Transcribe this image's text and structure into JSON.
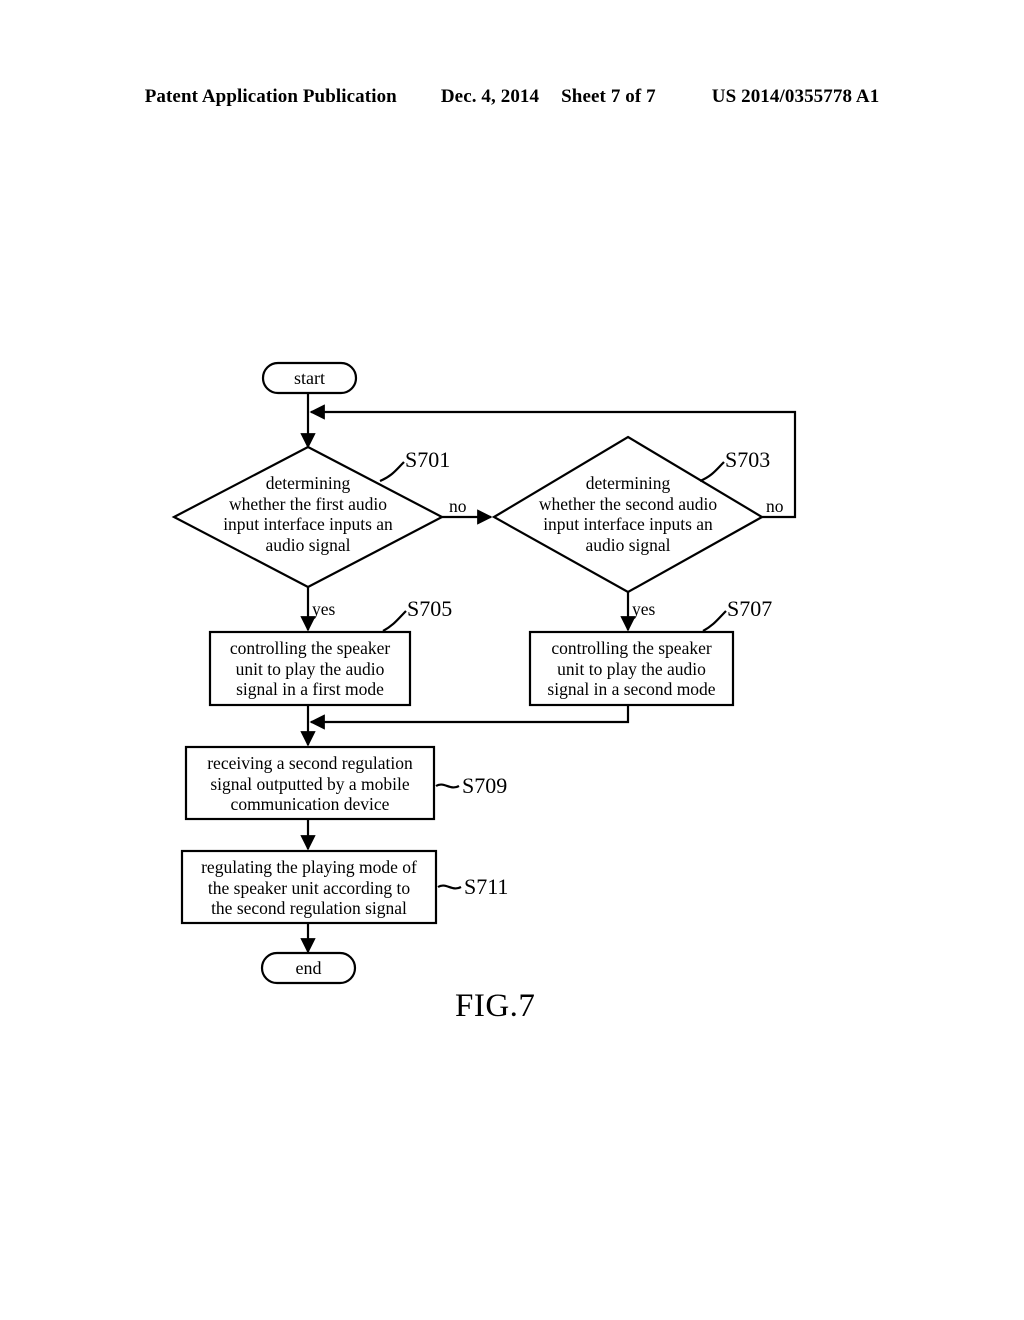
{
  "header": {
    "publication": "Patent Application Publication",
    "date": "Dec. 4, 2014",
    "sheet": "Sheet 7 of 7",
    "patent_number": "US 2014/0355778 A1"
  },
  "figure": {
    "caption": "FIG.7",
    "terminators": {
      "start": "start",
      "end": "end"
    },
    "decisions": [
      {
        "id": "S701",
        "label": "S701",
        "text": "determining\nwhether the first audio\ninput interface inputs an\naudio signal",
        "yes_label": "yes",
        "no_label": "no"
      },
      {
        "id": "S703",
        "label": "S703",
        "text": "determining\nwhether the second audio\ninput interface inputs an\naudio signal",
        "yes_label": "yes",
        "no_label": "no"
      }
    ],
    "processes": [
      {
        "id": "S705",
        "label": "S705",
        "text": "controlling the speaker\nunit to play the audio\nsignal in a first mode"
      },
      {
        "id": "S707",
        "label": "S707",
        "text": "controlling the speaker\nunit to play the audio\nsignal in a second mode"
      },
      {
        "id": "S709",
        "label": "S709",
        "text": "receiving a second regulation\nsignal outputted by a mobile\ncommunication device"
      },
      {
        "id": "S711",
        "label": "S711",
        "text": "regulating the playing mode of\nthe speaker unit according to\nthe second regulation signal"
      }
    ]
  }
}
